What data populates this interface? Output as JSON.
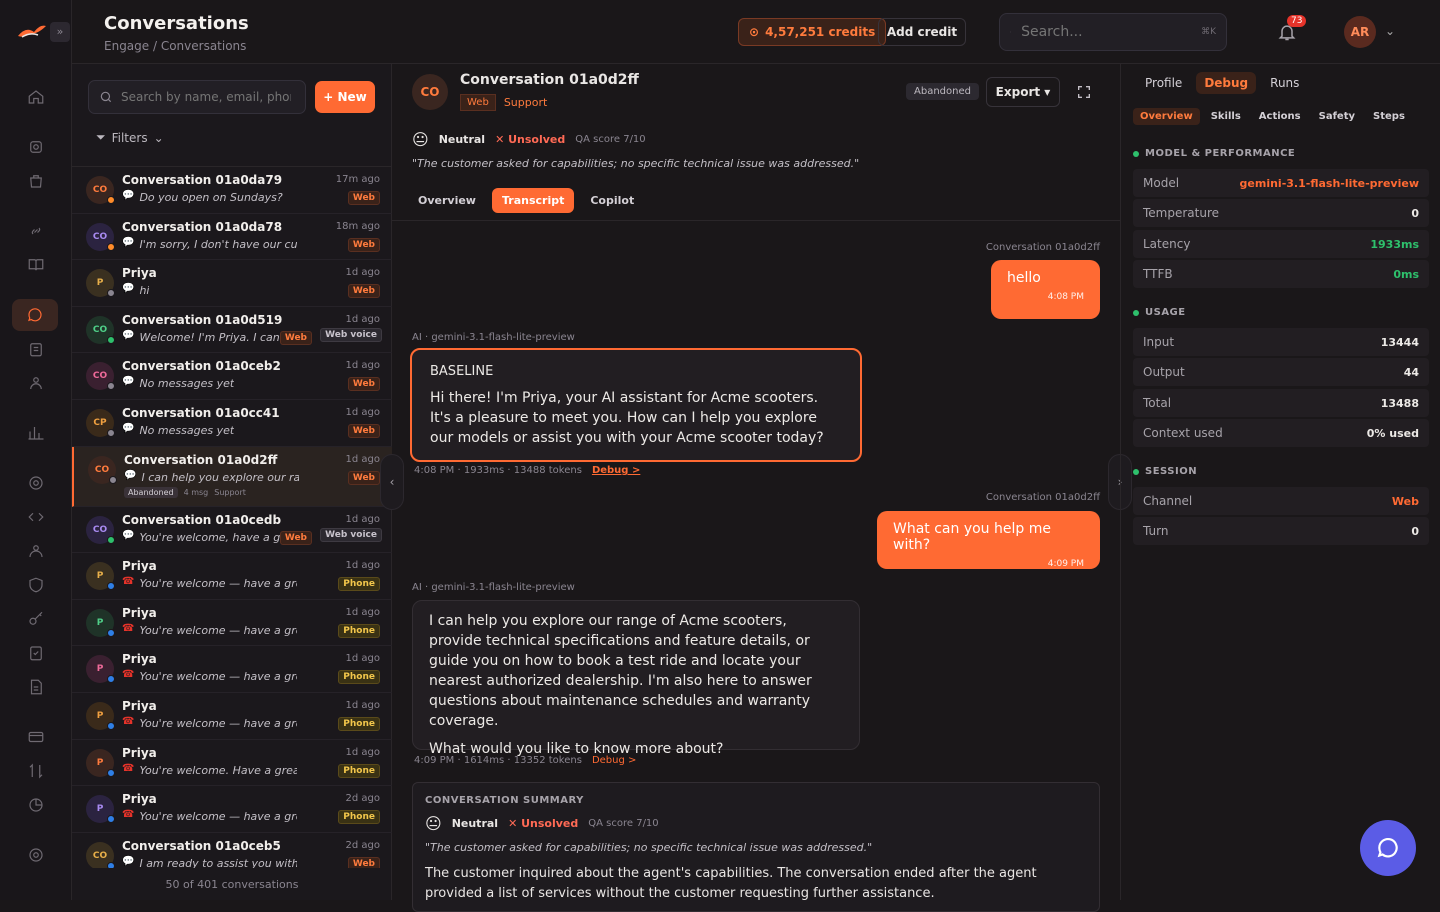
{
  "header": {
    "title": "Conversations",
    "breadcrumb": "Engage / Conversations",
    "credits": "4,57,251 credits",
    "add_credit": "Add credit",
    "search_placeholder": "Search...",
    "search_shortcut": "⌘K",
    "notifications": "73",
    "user_initials": "AR"
  },
  "list": {
    "search_placeholder": "Search by name, email, phone",
    "new_label": "+ New",
    "filters_label": "Filters",
    "footer": "50 of 401 conversations",
    "items": [
      {
        "initials": "CO",
        "name": "Conversation 01a0da79",
        "time": "17m ago",
        "msg": "Do you open on Sundays?",
        "tag": "Web"
      },
      {
        "initials": "CO",
        "name": "Conversation 01a0da78",
        "time": "18m ago",
        "msg": "I'm sorry, I don't have our current op...",
        "tag": "Web"
      },
      {
        "initials": "P",
        "name": "Priya",
        "time": "1d ago",
        "msg": "hi",
        "tag": "Web"
      },
      {
        "initials": "CO",
        "name": "Conversation 01a0d519",
        "time": "1d ago",
        "msg": "Welcome! I'm Priya. I can ...",
        "tag": "Web",
        "tag2": "Web voice"
      },
      {
        "initials": "CO",
        "name": "Conversation 01a0ceb2",
        "time": "1d ago",
        "msg": "No messages yet",
        "tag": "Web"
      },
      {
        "initials": "CP",
        "name": "Conversation 01a0cc41",
        "time": "1d ago",
        "msg": "No messages yet",
        "tag": "Web"
      },
      {
        "initials": "CO",
        "name": "Conversation 01a0d2ff",
        "time": "1d ago",
        "msg": "I can help you explore our range of ...",
        "tag": "Web",
        "status": "Abandoned",
        "sub": "4 msg",
        "sub2": "Support"
      },
      {
        "initials": "CO",
        "name": "Conversation 01a0cedb",
        "time": "1d ago",
        "msg": "You're welcome, have a g...",
        "tag": "Web",
        "tag2": "Web voice"
      },
      {
        "initials": "P",
        "name": "Priya",
        "time": "1d ago",
        "msg": "You're welcome — have a great day!",
        "tag": "Phone"
      },
      {
        "initials": "P",
        "name": "Priya",
        "time": "1d ago",
        "msg": "You're welcome — have a great day!",
        "tag": "Phone"
      },
      {
        "initials": "P",
        "name": "Priya",
        "time": "1d ago",
        "msg": "You're welcome — have a great day!",
        "tag": "Phone"
      },
      {
        "initials": "P",
        "name": "Priya",
        "time": "1d ago",
        "msg": "You're welcome — have a great day!",
        "tag": "Phone"
      },
      {
        "initials": "P",
        "name": "Priya",
        "time": "1d ago",
        "msg": "You're welcome. Have a great day!",
        "tag": "Phone"
      },
      {
        "initials": "P",
        "name": "Priya",
        "time": "2d ago",
        "msg": "You're welcome — have a great day!",
        "tag": "Phone"
      },
      {
        "initials": "CO",
        "name": "Conversation 01a0ceb5",
        "time": "2d ago",
        "msg": "I am ready to assist you with your r...",
        "tag": "Web"
      }
    ]
  },
  "conversation": {
    "initials": "CO",
    "title": "Conversation 01a0d2ff",
    "channel": "Web",
    "team": "Support",
    "status": "Abandoned",
    "export": "Export ▾",
    "sentiment": "Neutral",
    "resolution": "✕ Unsolved",
    "qa": "QA score 7/10",
    "quote": "\"The customer asked for capabilities; no specific technical issue was addressed.\"",
    "tabs": [
      "Overview",
      "Transcript",
      "Copilot"
    ],
    "messages": {
      "u1_label": "Conversation 01a0d2ff",
      "u1_text": "hello",
      "u1_time": "4:08 PM",
      "a1_label": "AI · gemini-3.1-flash-lite-preview",
      "a1_head": "BASELINE",
      "a1_text": "Hi there! I'm Priya, your AI assistant for Acme scooters. It's a pleasure to meet you. How can I help you explore our models or assist you with your Acme scooter today?",
      "a1_meta": "4:08 PM · 1933ms · 13488 tokens",
      "a1_debug": "Debug >",
      "u2_label": "Conversation 01a0d2ff",
      "u2_text": "What can you help me with?",
      "u2_time": "4:09 PM",
      "a2_label": "AI · gemini-3.1-flash-lite-preview",
      "a2_text": "I can help you explore our range of Acme scooters, provide technical specifications and feature details, or guide you on how to book a test ride and locate your nearest authorized dealership. I'm also here to answer questions about maintenance schedules and warranty coverage.",
      "a2_text2": "What would you like to know more about?",
      "a2_meta": "4:09 PM · 1614ms · 13352 tokens",
      "a2_debug": "Debug >"
    },
    "summary": {
      "heading": "CONVERSATION SUMMARY",
      "sentiment": "Neutral",
      "resolution": "✕ Unsolved",
      "qa": "QA score 7/10",
      "quote": "\"The customer asked for capabilities; no specific technical issue was addressed.\"",
      "text": "The customer inquired about the agent's capabilities. The conversation ended after the agent provided a list of services without the customer requesting further assistance."
    }
  },
  "debug": {
    "tabs": [
      "Profile",
      "Debug",
      "Runs"
    ],
    "subtabs": [
      "Overview",
      "Skills",
      "Actions",
      "Safety",
      "Steps"
    ],
    "sections": {
      "model_title": "MODEL & PERFORMANCE",
      "usage_title": "USAGE",
      "session_title": "SESSION"
    },
    "model": "gemini-3.1-flash-lite-preview",
    "temperature": "0",
    "latency": "1933ms",
    "ttfb": "0ms",
    "input": "13444",
    "output": "44",
    "total": "13488",
    "context": "0% used",
    "channel": "Web",
    "turn": "0",
    "labels": {
      "model": "Model",
      "temperature": "Temperature",
      "latency": "Latency",
      "ttfb": "TTFB",
      "input": "Input",
      "output": "Output",
      "total": "Total",
      "context": "Context used",
      "channel": "Channel",
      "turn": "Turn"
    }
  }
}
